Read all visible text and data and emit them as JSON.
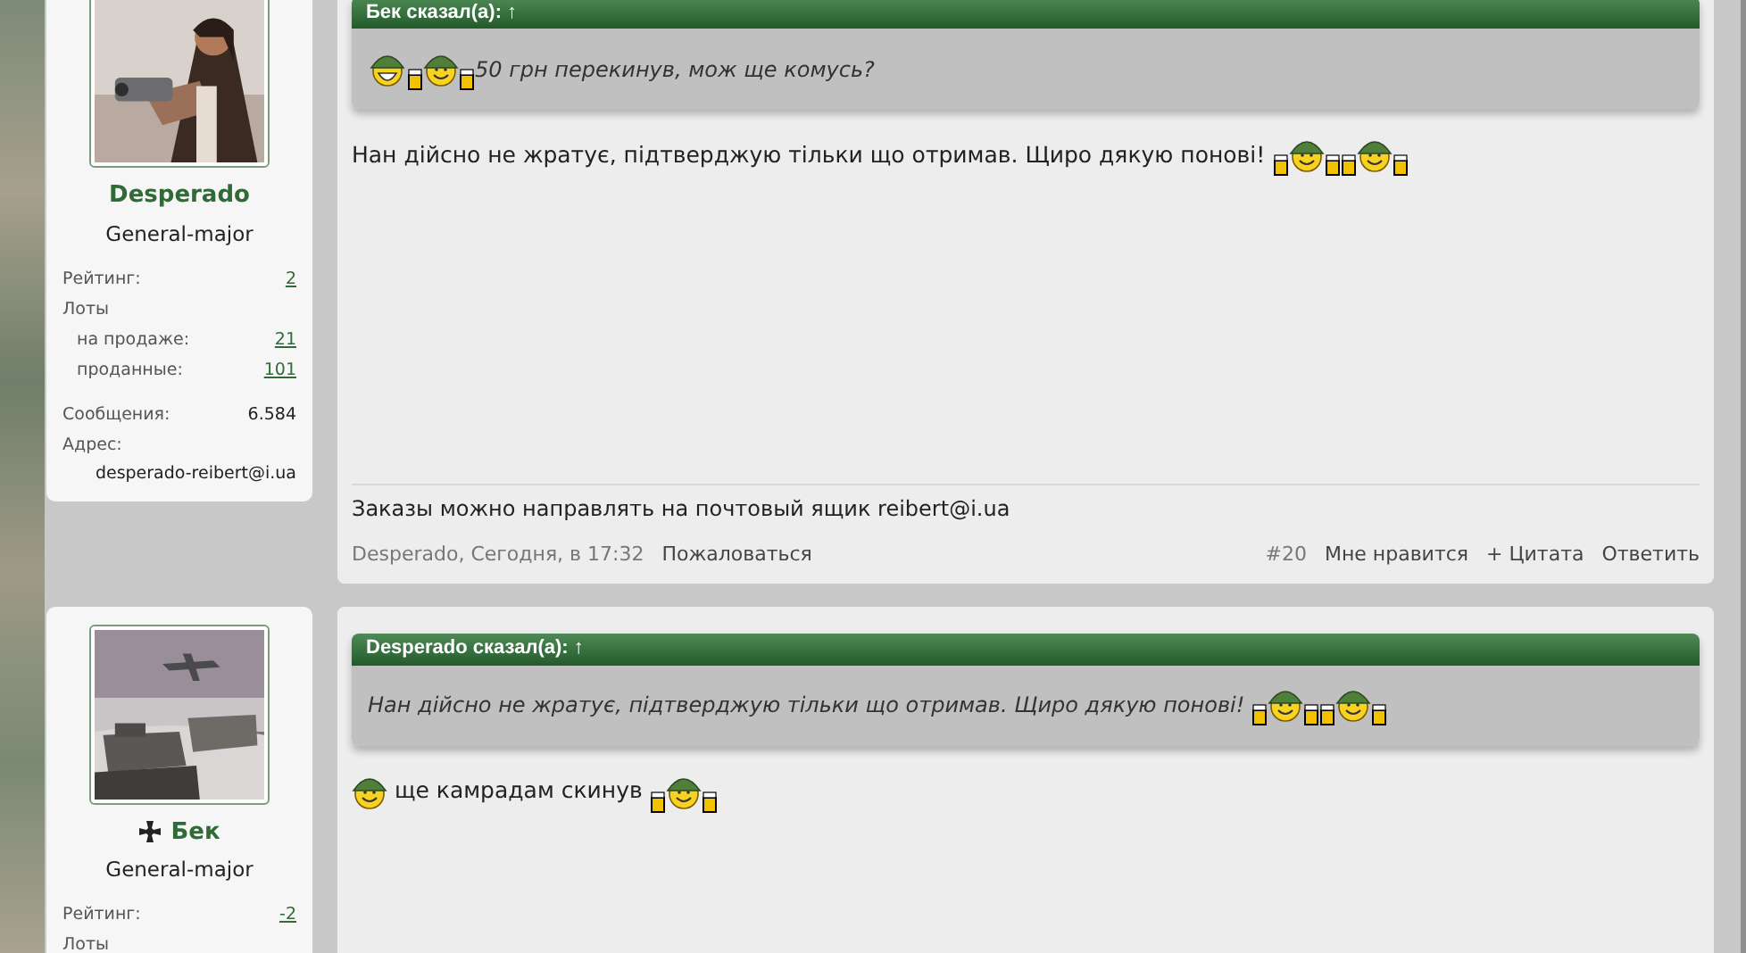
{
  "posts": [
    {
      "user": {
        "insignia": false,
        "name": "Desperado",
        "rank": "General-major",
        "stat_groups": [
          [
            {
              "kind": "link",
              "label": "Рейтинг:",
              "value": "2"
            },
            {
              "kind": "heading",
              "label": "Лоты",
              "children": [
                {
                  "kind": "link",
                  "label": "на продаже:",
                  "value": "21"
                },
                {
                  "kind": "link",
                  "label": "проданные:",
                  "value": "101"
                }
              ]
            }
          ],
          [
            {
              "kind": "plain",
              "label": "Сообщения:",
              "value": "6.584"
            },
            {
              "kind": "block",
              "label": "Адрес:",
              "value": "desperado-reibert@i.ua"
            }
          ]
        ]
      },
      "quote": {
        "author": "Бек сказал(а):",
        "arrow": "↑",
        "content": [
          {
            "kind": "smiley-grin"
          },
          {
            "kind": "smiley-beers"
          },
          {
            "kind": "text",
            "text": "50 грн перекинув, мож ще комусь?"
          }
        ]
      },
      "message": [
        {
          "kind": "text",
          "text": "Нан дійсно не жратує, підтверджую тільки що отримав. Щиро дякую понові! "
        },
        {
          "kind": "smiley-beers"
        },
        {
          "kind": "smiley-beers"
        }
      ],
      "signature": "Заказы можно направлять на почтовый ящик reibert@i.ua",
      "footer": {
        "byline": "Desperado, Сегодня, в 17:32",
        "report": "Пожаловаться",
        "number": "#20",
        "actions": [
          "Мне нравится",
          "+ Цитата",
          "Ответить"
        ]
      }
    },
    {
      "user": {
        "insignia": true,
        "name": "Бек",
        "rank": "General-major",
        "stat_groups": [
          [
            {
              "kind": "link",
              "label": "Рейтинг:",
              "value": "-2"
            },
            {
              "kind": "heading",
              "label": "Лоты"
            }
          ]
        ]
      },
      "quote": {
        "author": "Desperado сказал(а):",
        "arrow": "↑",
        "content": [
          {
            "kind": "text",
            "text": "Нан дійсно не жратує, підтверджую тільки що отримав. Щиро дякую понові! "
          },
          {
            "kind": "smiley-beers"
          },
          {
            "kind": "smiley-beers"
          }
        ]
      },
      "message": [
        {
          "kind": "smiley"
        },
        {
          "kind": "text",
          "text": " ще камрадам скинув "
        },
        {
          "kind": "smiley-beers"
        }
      ]
    }
  ]
}
